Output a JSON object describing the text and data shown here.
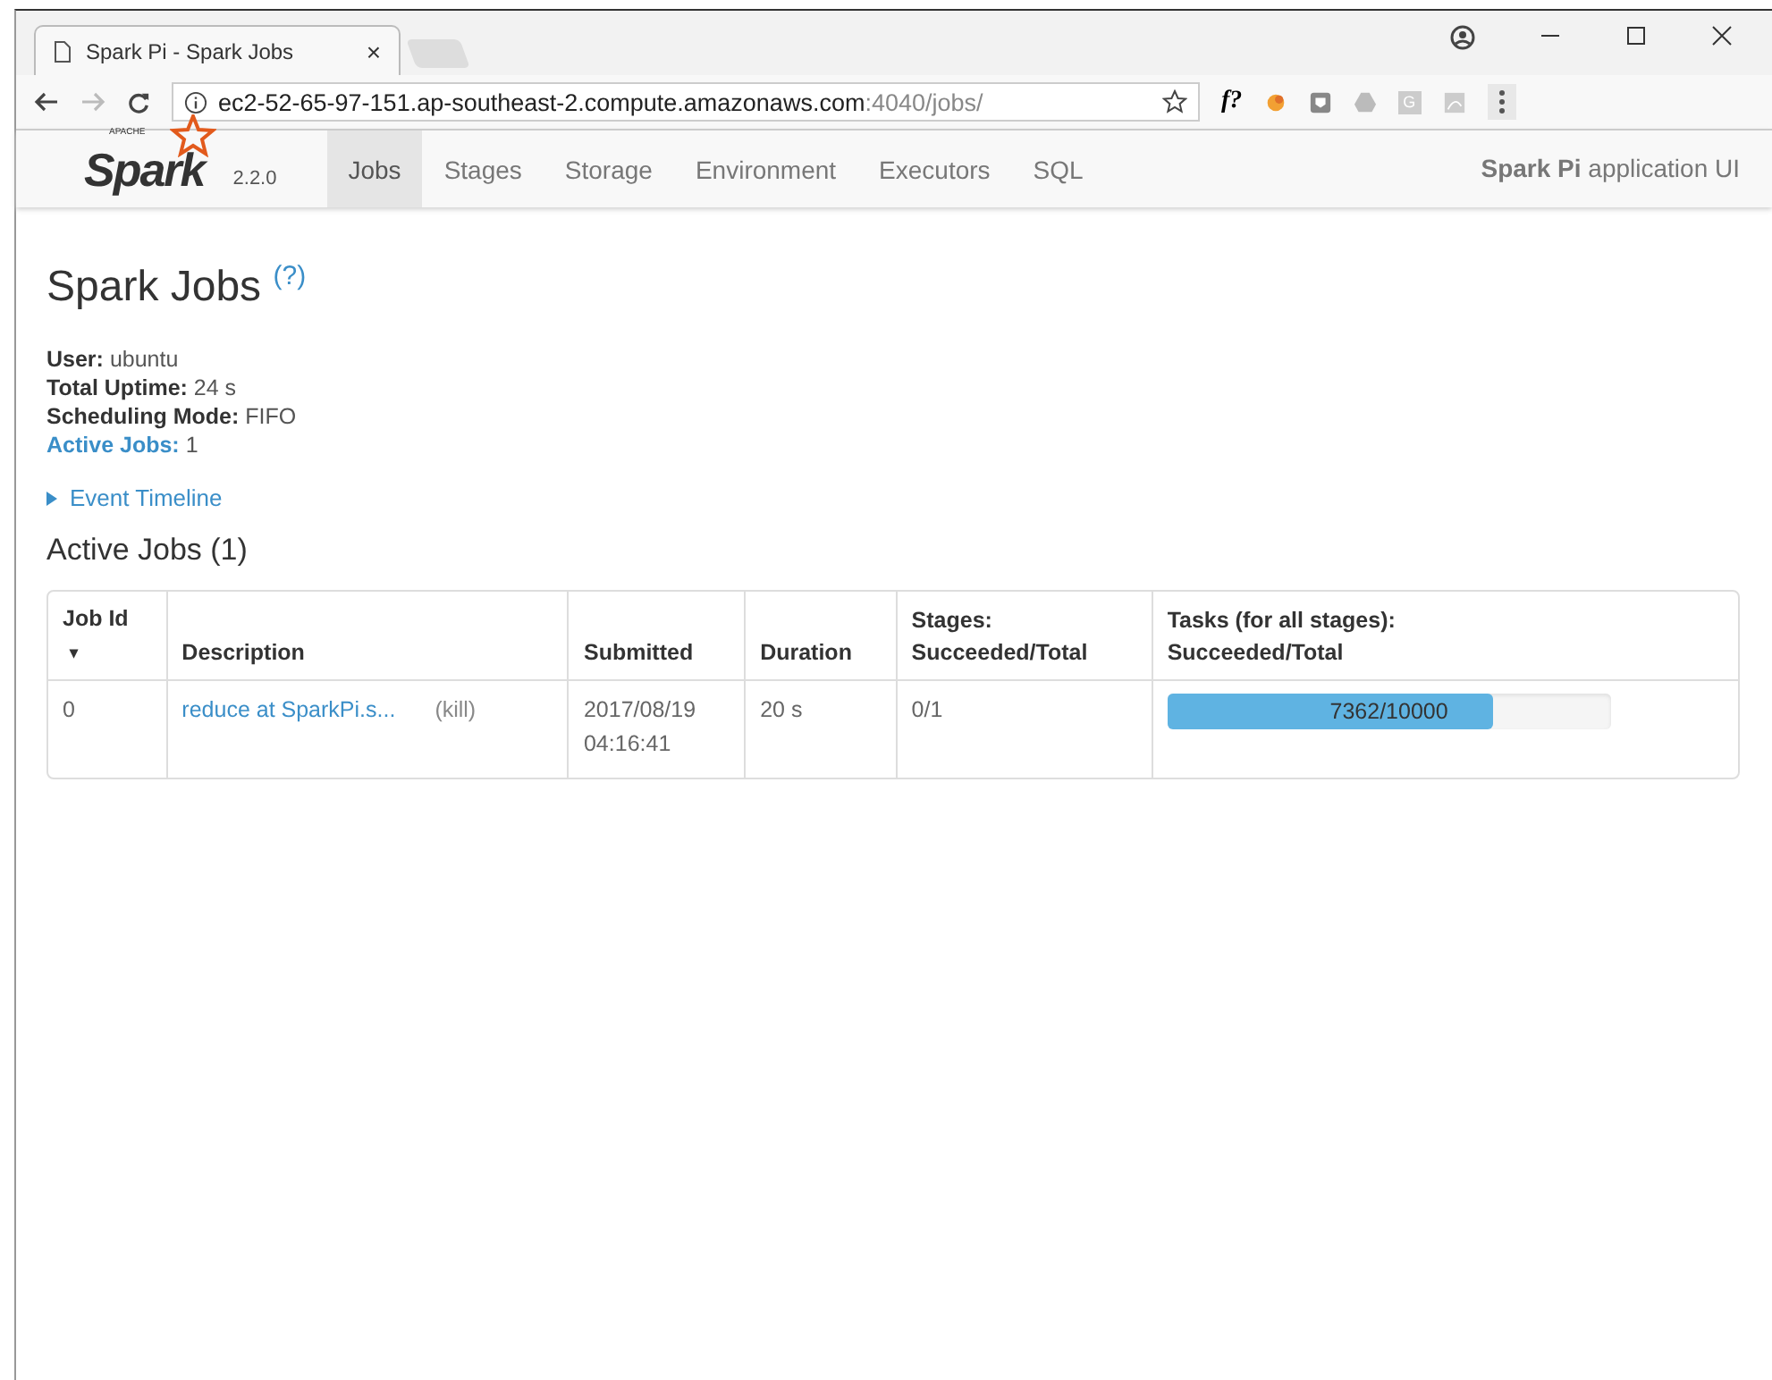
{
  "browser": {
    "tab": {
      "title": "Spark Pi - Spark Jobs",
      "close": "×"
    },
    "url": {
      "host": "ec2-52-65-97-151.ap-southeast-2.compute.amazonaws.com",
      "rest": ":4040/jobs/"
    },
    "extension_text": "f?",
    "extension_letter": "G"
  },
  "navbar": {
    "logo": {
      "brand": "Spark",
      "tag": "APACHE",
      "version": "2.2.0"
    },
    "tabs": [
      {
        "label": "Jobs",
        "selected": true
      },
      {
        "label": "Stages",
        "selected": false
      },
      {
        "label": "Storage",
        "selected": false
      },
      {
        "label": "Environment",
        "selected": false
      },
      {
        "label": "Executors",
        "selected": false
      },
      {
        "label": "SQL",
        "selected": false
      }
    ],
    "app_title": "**Spark Pi** application UI"
  },
  "page": {
    "title": "Spark Jobs",
    "help": "(?)",
    "summary": [
      {
        "label": "User:",
        "value": "ubuntu",
        "link": false
      },
      {
        "label": "Total Uptime:",
        "value": "24 s",
        "link": false
      },
      {
        "label": "Scheduling Mode:",
        "value": "FIFO",
        "link": false
      },
      {
        "label": "Active Jobs:",
        "value": "1",
        "link": true
      }
    ],
    "event_timeline": {
      "label": "Event Timeline",
      "expanded": false
    },
    "section_title": "Active Jobs (1)"
  },
  "table": {
    "columns": [
      "Job Id",
      "Description",
      "Submitted",
      "Duration",
      "Stages:\nSucceeded/Total",
      "Tasks (for all stages):\nSucceeded/Total"
    ],
    "sort_mark": "▾",
    "rows": [
      {
        "job_id": "0",
        "description": "reduce at SparkPi.s...",
        "kill": "(kill)",
        "submitted": "2017/08/19\n04:16:41",
        "duration": "20 s",
        "stages": "0/1",
        "tasks": "7362/10000",
        "level": 0.7362
      }
    ]
  }
}
